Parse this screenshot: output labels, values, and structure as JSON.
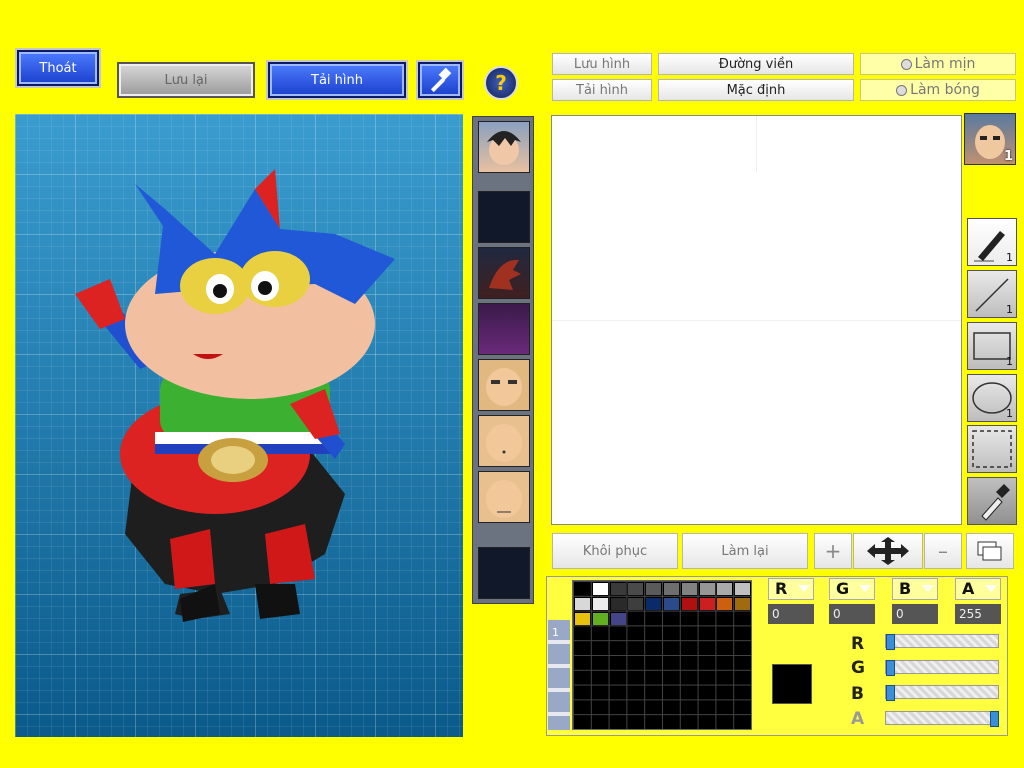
{
  "top_left": {
    "exit_label": "Thoát",
    "save_label": "Lưu lại",
    "load_label": "Tải hình",
    "help_symbol": "?"
  },
  "top_right": {
    "save_image_label": "Lưu hình",
    "load_image_label": "Tải hình",
    "outline_label": "Đường viền",
    "default_label": "Mặc định",
    "smooth_label": "Làm mịn",
    "shade_label": "Làm bóng"
  },
  "portrait_count": "1",
  "tools": [
    {
      "name": "pen-tool",
      "count": "1"
    },
    {
      "name": "line-tool",
      "count": "1"
    },
    {
      "name": "rectangle-tool",
      "count": "1"
    },
    {
      "name": "ellipse-tool",
      "count": "1"
    },
    {
      "name": "select-tool",
      "count": ""
    },
    {
      "name": "eyedropper-tool",
      "count": ""
    }
  ],
  "bottom_buttons": {
    "restore_label": "Khôi phục",
    "redo_label": "Làm lại"
  },
  "color": {
    "r_label": "R",
    "g_label": "G",
    "b_label": "B",
    "a_label": "A",
    "r_value": "0",
    "g_value": "0",
    "b_value": "0",
    "a_value": "255",
    "r_level": 0,
    "g_level": 0,
    "b_level": 0,
    "a_level": 1.0,
    "current": "#000000",
    "tab_number": "1"
  },
  "palette": [
    "#000000",
    "#ffffff",
    "#3a3a3a",
    "#4a4a4a",
    "#5a5a5a",
    "#6e6e6e",
    "#828282",
    "#969696",
    "#aaaaaa",
    "#c0c0c0",
    "#d8d8d8",
    "#ececec",
    "#2a2a2a",
    "#3e3e3e",
    "#0a2a6a",
    "#2a4a8a",
    "#b01010",
    "#cc2020",
    "#cc6010",
    "#a06a10",
    "#e8c010",
    "#60b020",
    "#444488"
  ]
}
